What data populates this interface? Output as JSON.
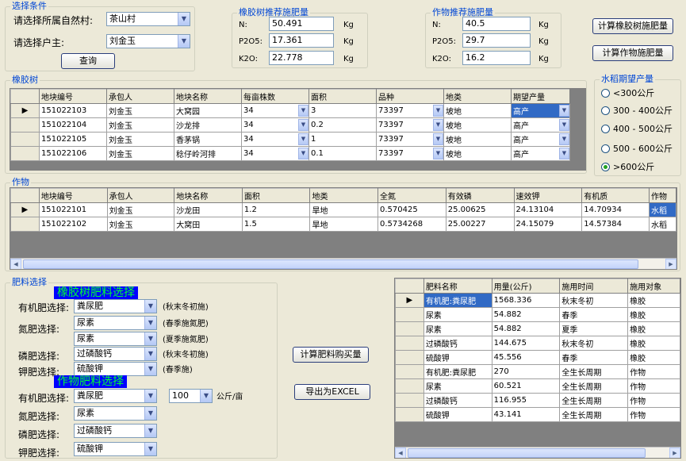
{
  "conditions": {
    "title": "选择条件",
    "village_label": "请选择所属自然村:",
    "village_value": "茶山村",
    "owner_label": "请选择户主:",
    "owner_value": "刘金玉",
    "query_button": "查询"
  },
  "rubber_rec": {
    "title": "橡胶树推荐施肥量",
    "rows": [
      {
        "label": "N:",
        "value": "50.491",
        "unit": "Kg"
      },
      {
        "label": "P2O5:",
        "value": "17.361",
        "unit": "Kg"
      },
      {
        "label": "K2O:",
        "value": "22.778",
        "unit": "Kg"
      }
    ]
  },
  "crop_rec": {
    "title": "作物推荐施肥量",
    "rows": [
      {
        "label": "N:",
        "value": "40.5",
        "unit": "Kg"
      },
      {
        "label": "P2O5:",
        "value": "29.7",
        "unit": "Kg"
      },
      {
        "label": "K2O:",
        "value": "16.2",
        "unit": "Kg"
      }
    ]
  },
  "buttons": {
    "calc_rubber": "计算橡胶树施肥量",
    "calc_crop": "计算作物施肥量",
    "calc_purchase": "计算肥料购买量",
    "export_excel": "导出为EXCEL"
  },
  "rubber_grid": {
    "title": "橡胶树",
    "columns": [
      "地块编号",
      "承包人",
      "地块名称",
      "每亩株数",
      "面积",
      "品种",
      "地类",
      "期望产量"
    ],
    "rows": [
      [
        "151022103",
        "刘金玉",
        "大窝园",
        "34",
        "3",
        "73397",
        "坡地",
        "高产"
      ],
      [
        "151022104",
        "刘金玉",
        "沙龙排",
        "34",
        "0.2",
        "73397",
        "坡地",
        "高产"
      ],
      [
        "151022105",
        "刘金玉",
        "香茅锅",
        "34",
        "1",
        "73397",
        "坡地",
        "高产"
      ],
      [
        "151022106",
        "刘金玉",
        "稔仔岭河排",
        "34",
        "0.1",
        "73397",
        "坡地",
        "高产"
      ]
    ]
  },
  "rice_yield": {
    "title": "水稻期望产量",
    "options": [
      "<300公斤",
      "300 - 400公斤",
      "400 - 500公斤",
      "500 - 600公斤",
      ">600公斤"
    ],
    "selected_index": 4
  },
  "crop_grid": {
    "title": "作物",
    "columns": [
      "地块编号",
      "承包人",
      "地块名称",
      "面积",
      "地类",
      "全氮",
      "有效磷",
      "速效钾",
      "有机质",
      "作物"
    ],
    "rows": [
      [
        "151022101",
        "刘金玉",
        "沙龙田",
        "1.2",
        "旱地",
        "0.570425",
        "25.00625",
        "24.13104",
        "14.70934",
        "水稻"
      ],
      [
        "151022102",
        "刘金玉",
        "大窝田",
        "1.5",
        "旱地",
        "0.5734268",
        "25.00227",
        "24.15079",
        "14.57384",
        "水稻"
      ]
    ]
  },
  "fertilizer_select": {
    "title": "肥料选择",
    "rubber_banner": "橡胶树肥料选择",
    "crop_banner": "作物肥料选择",
    "rubber_rows": [
      {
        "label": "有机肥选择:",
        "value": "粪尿肥",
        "note": "(秋末冬初施)"
      },
      {
        "label": "氮肥选择:",
        "value": "尿素",
        "note": "(春季施氮肥)"
      },
      {
        "label": "",
        "value": "尿素",
        "note": "(夏季施氮肥)"
      },
      {
        "label": "磷肥选择:",
        "value": "过磷酸钙",
        "note": "(秋末冬初施)"
      },
      {
        "label": "钾肥选择:",
        "value": "硫酸钾",
        "note": "(春季施)"
      }
    ],
    "crop_rows": [
      {
        "label": "有机肥选择:",
        "value": "粪尿肥"
      },
      {
        "label": "氮肥选择:",
        "value": "尿素"
      },
      {
        "label": "磷肥选择:",
        "value": "过磷酸钙"
      },
      {
        "label": "钾肥选择:",
        "value": "硫酸钾"
      }
    ],
    "organic_amount": "100",
    "organic_unit": "公斤/亩"
  },
  "result_grid": {
    "columns": [
      "肥料名称",
      "用量(公斤)",
      "施用时间",
      "施用对象"
    ],
    "rows": [
      [
        "有机肥:粪尿肥",
        "1568.336",
        "秋末冬初",
        "橡胶"
      ],
      [
        "尿素",
        "54.882",
        "春季",
        "橡胶"
      ],
      [
        "尿素",
        "54.882",
        "夏季",
        "橡胶"
      ],
      [
        "过磷酸钙",
        "144.675",
        "秋末冬初",
        "橡胶"
      ],
      [
        "硫酸钾",
        "45.556",
        "春季",
        "橡胶"
      ],
      [
        "有机肥:粪尿肥",
        "270",
        "全生长周期",
        "作物"
      ],
      [
        "尿素",
        "60.521",
        "全生长周期",
        "作物"
      ],
      [
        "过磷酸钙",
        "116.955",
        "全生长周期",
        "作物"
      ],
      [
        "硫酸钾",
        "43.141",
        "全生长周期",
        "作物"
      ]
    ]
  }
}
